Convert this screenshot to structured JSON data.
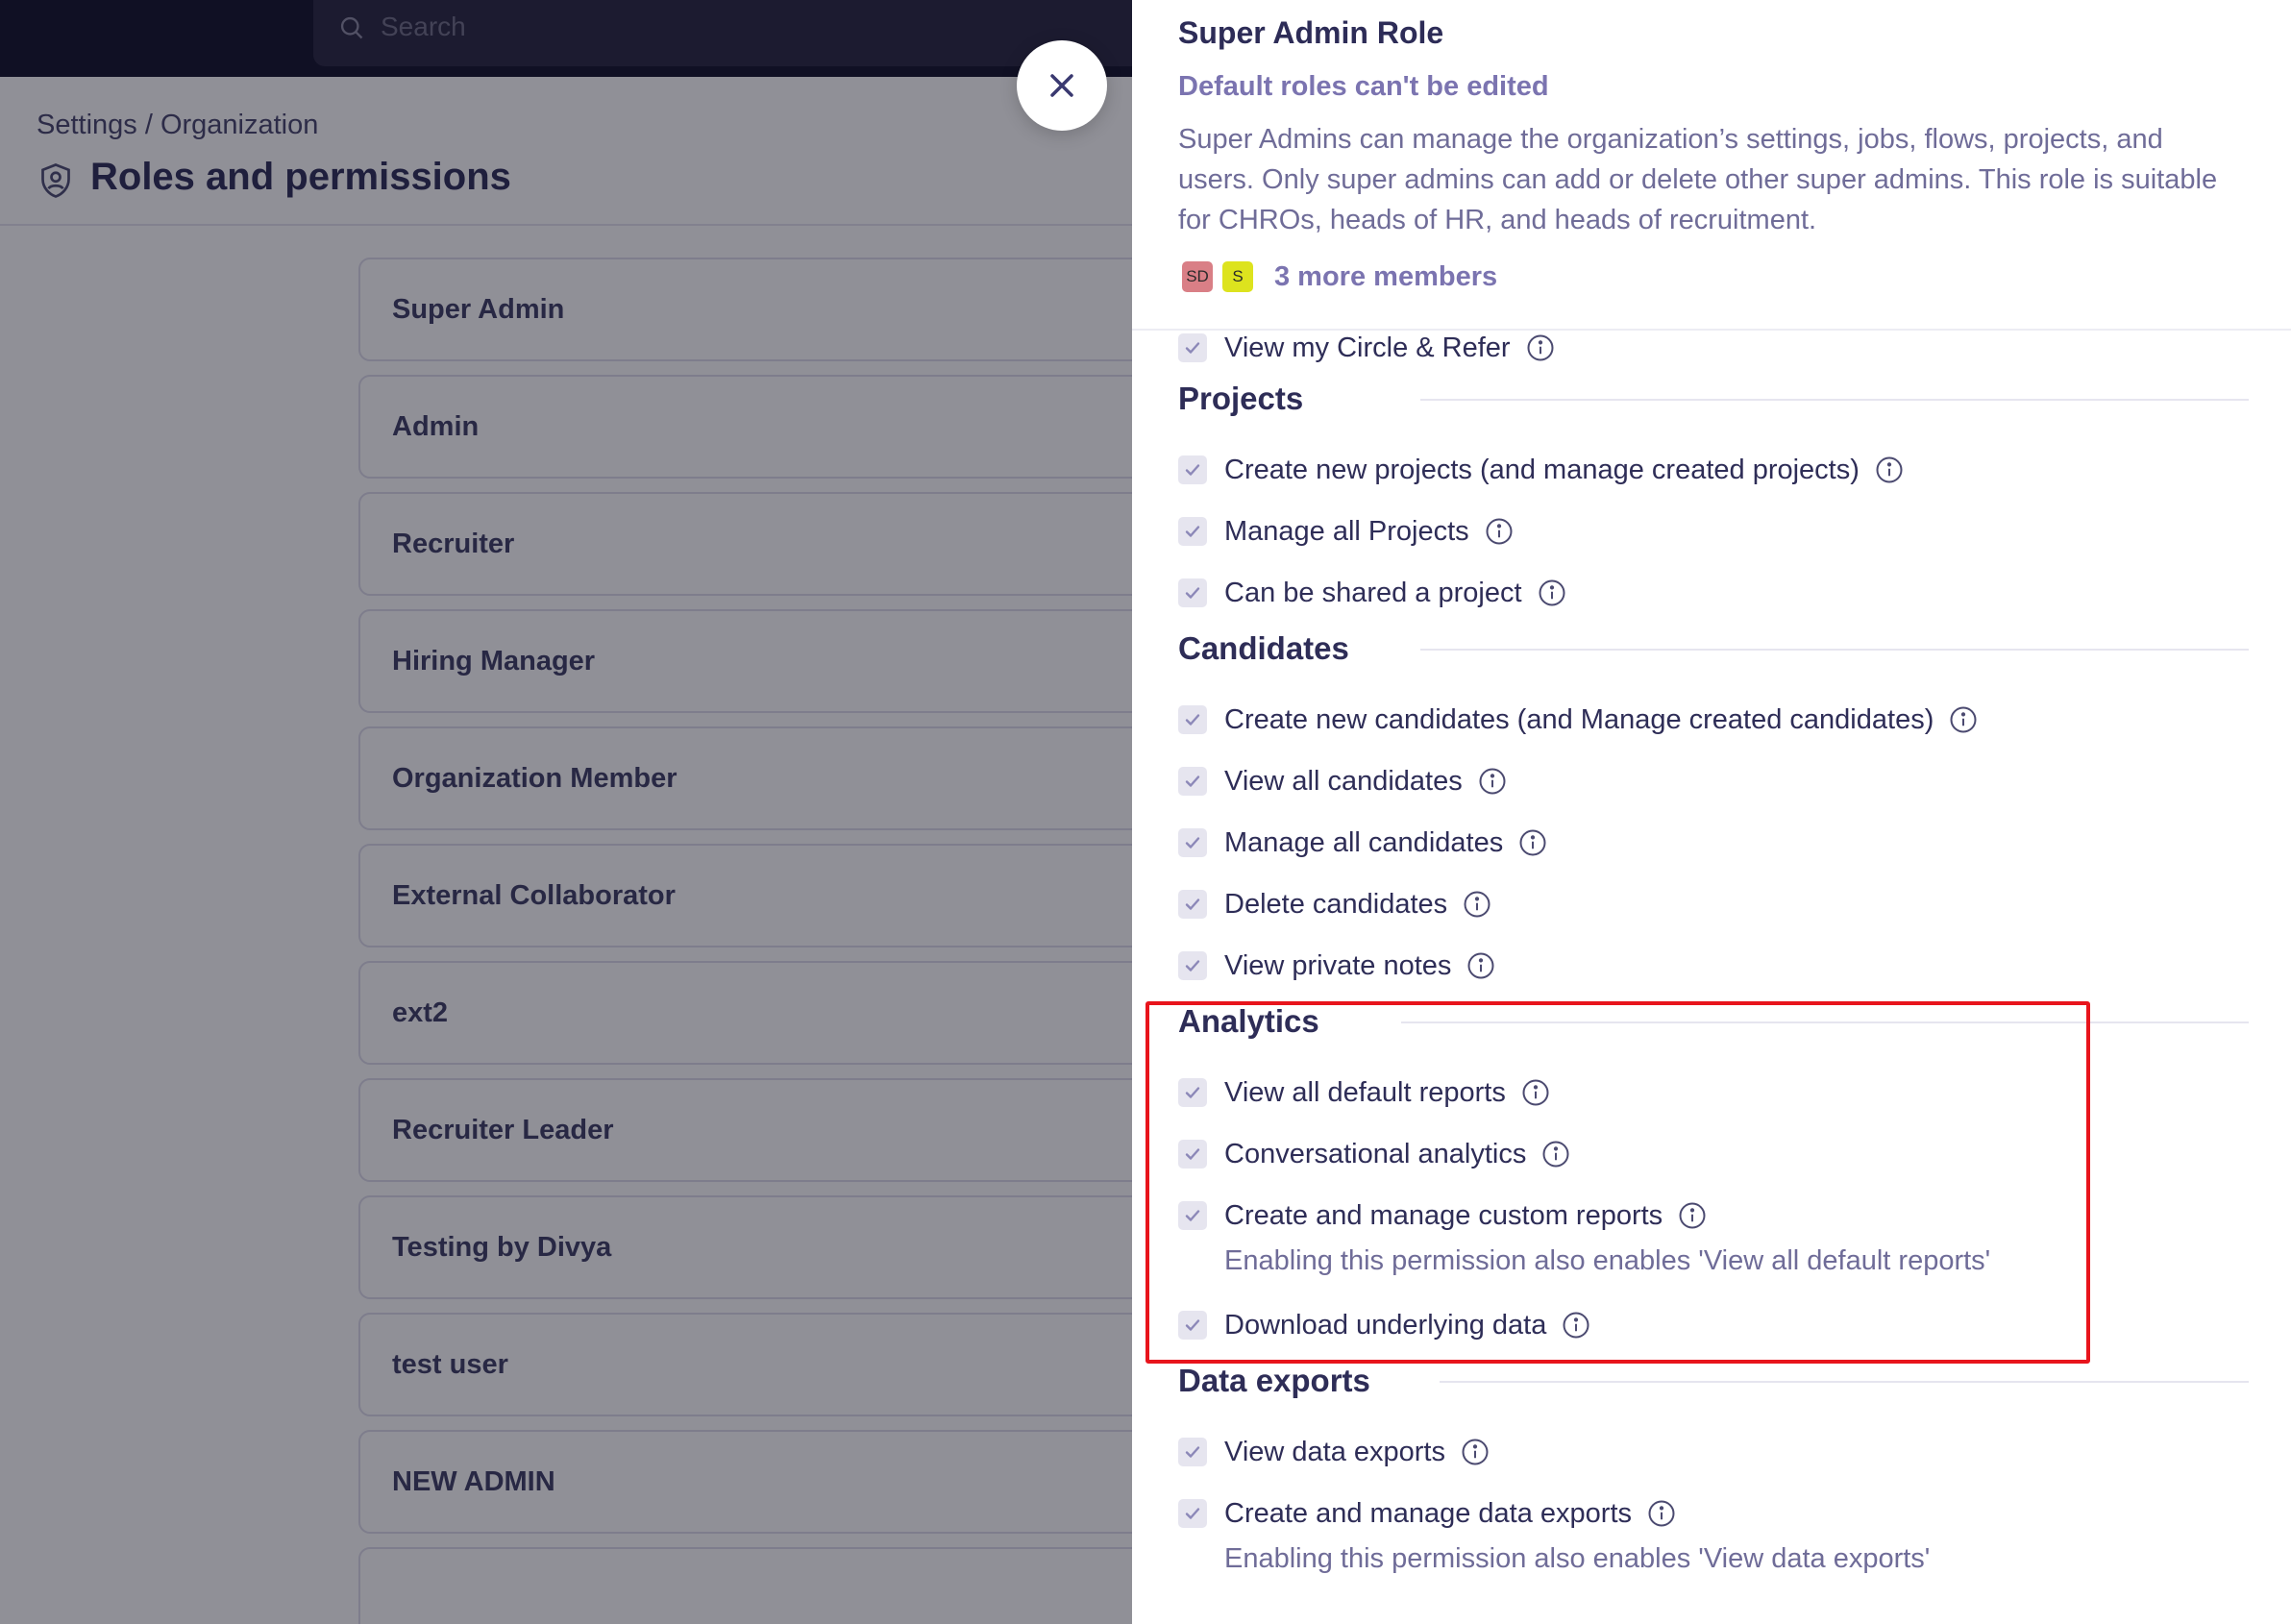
{
  "search": {
    "placeholder": "Search"
  },
  "header": {
    "breadcrumb": "Settings / Organization",
    "title": "Roles and permissions"
  },
  "roles": [
    "Super Admin",
    "Admin",
    "Recruiter",
    "Hiring Manager",
    "Organization Member",
    "External Collaborator",
    "ext2",
    "Recruiter Leader",
    "Testing by Divya",
    "test user",
    "NEW ADMIN"
  ],
  "drawer": {
    "title": "Super Admin Role",
    "note": "Default roles can't be edited",
    "description": "Super Admins can manage the organization’s settings, jobs, flows, projects, and users. Only super admins can add or delete other super admins. This role is suitable for CHROs, heads of HR, and heads of recruitment.",
    "avatars": [
      "SD",
      "S"
    ],
    "more_members": "3 more members",
    "partial_permission": "View my Circle & Refer",
    "sections": {
      "projects": {
        "title": "Projects",
        "items": [
          "Create new projects (and manage created projects)",
          "Manage all Projects",
          "Can be shared a project"
        ]
      },
      "candidates": {
        "title": "Candidates",
        "items": [
          "Create new candidates (and Manage created candidates)",
          "View all candidates",
          "Manage all candidates",
          "Delete candidates",
          "View private notes"
        ]
      },
      "analytics": {
        "title": "Analytics",
        "items": [
          "View all default reports",
          "Conversational analytics",
          "Create and manage custom reports",
          "Download underlying data"
        ],
        "custom_reports_note": "Enabling this permission also enables 'View all default reports'"
      },
      "data_exports": {
        "title": "Data exports",
        "items": [
          "View data exports",
          "Create and manage data exports"
        ],
        "manage_note": "Enabling this permission also enables 'View data exports'"
      }
    }
  },
  "colors": {
    "topbar": "#0f0e26",
    "text_primary": "#2e2d57",
    "text_muted": "#6f6c98",
    "accent": "#7b74b0",
    "highlight": "#e8141c"
  }
}
